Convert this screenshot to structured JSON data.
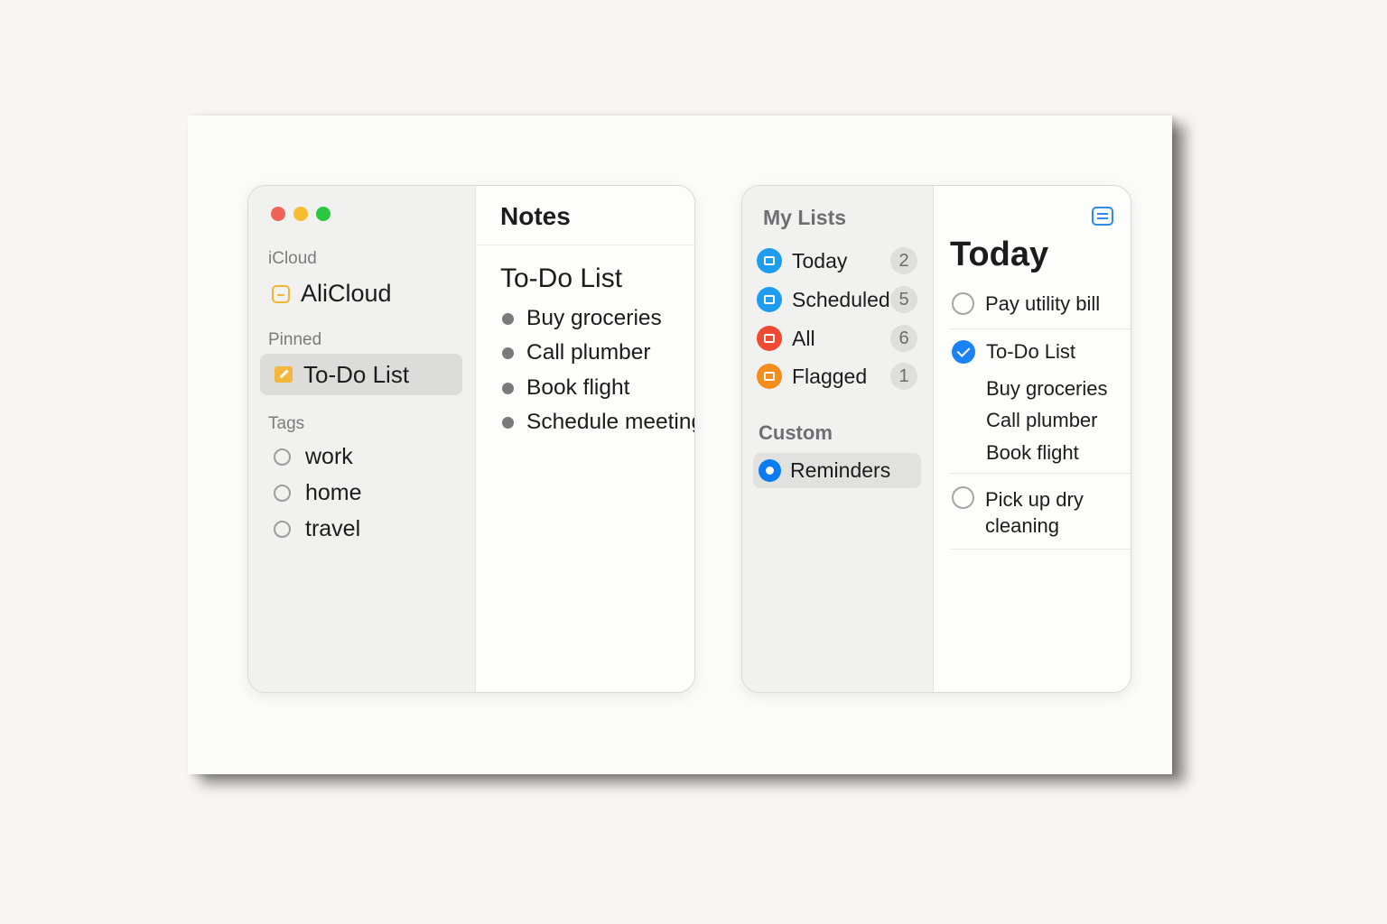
{
  "colors": {
    "traffic_red": "#f0635a",
    "traffic_yellow": "#f5bd2f",
    "traffic_green": "#2ac840",
    "accent_blue": "#0a7cf2",
    "today_blue": "#1d9cf0",
    "all_red": "#f04b32",
    "flagged_orange": "#f58d1c",
    "folder_yellow": "#f1b531"
  },
  "notes_sidebar": {
    "icloud_label": "iCloud",
    "folder": {
      "label": "AliCloud",
      "icon": "folder-icon"
    },
    "pinned_label": "Pinned",
    "pinned_item": {
      "label": "To-Do List",
      "icon": "note-icon"
    },
    "tags_label": "Tags",
    "tags": [
      "work",
      "home",
      "travel"
    ]
  },
  "notes_main": {
    "title": "Notes",
    "note_title": "To-Do List",
    "bullets": [
      "Buy groceries",
      "Call plumber",
      "Book flight",
      "Schedule meeting"
    ]
  },
  "reminders_sidebar": {
    "header": "My Lists",
    "lists": [
      {
        "label": "Today",
        "count": "2",
        "icon": "today-icon"
      },
      {
        "label": "Scheduled",
        "count": "5",
        "icon": "calendar-icon"
      },
      {
        "label": "All",
        "count": "6",
        "icon": "tray-icon"
      },
      {
        "label": "Flagged",
        "count": "1",
        "icon": "flag-icon"
      }
    ],
    "custom_label": "Custom",
    "custom_item": "Reminders"
  },
  "reminders_main": {
    "title": "Today",
    "tasks": [
      {
        "label": "Pay utility bill",
        "done": false
      },
      {
        "label": "To-Do List",
        "done": true,
        "subtasks": [
          "Buy groceries",
          "Call plumber",
          "Book flight"
        ]
      },
      {
        "label_line1": "Pick up dry",
        "label_line2": "cleaning",
        "done": false
      }
    ]
  }
}
